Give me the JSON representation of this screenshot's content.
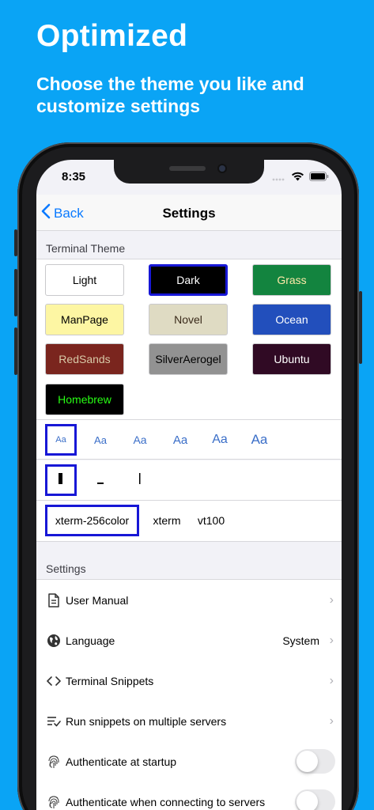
{
  "promo": {
    "headline": "Optimized",
    "subline": "Choose the theme you like and customize settings"
  },
  "status_bar": {
    "time": "8:35"
  },
  "navbar": {
    "back_label": "Back",
    "title": "Settings"
  },
  "terminal_theme": {
    "header": "Terminal Theme",
    "themes": [
      {
        "name": "Light",
        "bg": "#ffffff",
        "fg": "#000000",
        "selected": false
      },
      {
        "name": "Dark",
        "bg": "#000000",
        "fg": "#ffffff",
        "selected": true
      },
      {
        "name": "Grass",
        "bg": "#13843f",
        "fg": "#ffe9a8",
        "selected": false
      },
      {
        "name": "ManPage",
        "bg": "#fdf6a3",
        "fg": "#000000",
        "selected": false
      },
      {
        "name": "Novel",
        "bg": "#dfdbc3",
        "fg": "#3a2a1a",
        "selected": false
      },
      {
        "name": "Ocean",
        "bg": "#224fbc",
        "fg": "#ffffff",
        "selected": false
      },
      {
        "name": "RedSands",
        "bg": "#7a251e",
        "fg": "#d7c9a7",
        "selected": false
      },
      {
        "name": "SilverAerogel",
        "bg": "#929292",
        "fg": "#000000",
        "selected": false
      },
      {
        "name": "Ubuntu",
        "bg": "#300a24",
        "fg": "#ffffff",
        "selected": false
      },
      {
        "name": "Homebrew",
        "bg": "#000000",
        "fg": "#28fe14",
        "selected": false
      }
    ]
  },
  "font_sizes": {
    "label": "Aa",
    "sizes": [
      11,
      13,
      14,
      15,
      16,
      17
    ],
    "selected_index": 0
  },
  "cursor_styles": {
    "options": [
      "block-cursor",
      "underline-cursor",
      "bar-cursor"
    ],
    "selected_index": 0
  },
  "terminal_types": {
    "options": [
      "xterm-256color",
      "xterm",
      "vt100"
    ],
    "selected_index": 0
  },
  "settings": {
    "header": "Settings",
    "user_manual": "User Manual",
    "language": "Language",
    "language_value": "System",
    "terminal_snippets": "Terminal Snippets",
    "run_snippets": "Run snippets on multiple servers",
    "auth_startup": "Authenticate at startup",
    "auth_connect": "Authenticate when connecting to servers"
  },
  "colors": {
    "background": "#0aa4f5",
    "accent": "#0a7aff",
    "selection_border": "#1717d6"
  }
}
